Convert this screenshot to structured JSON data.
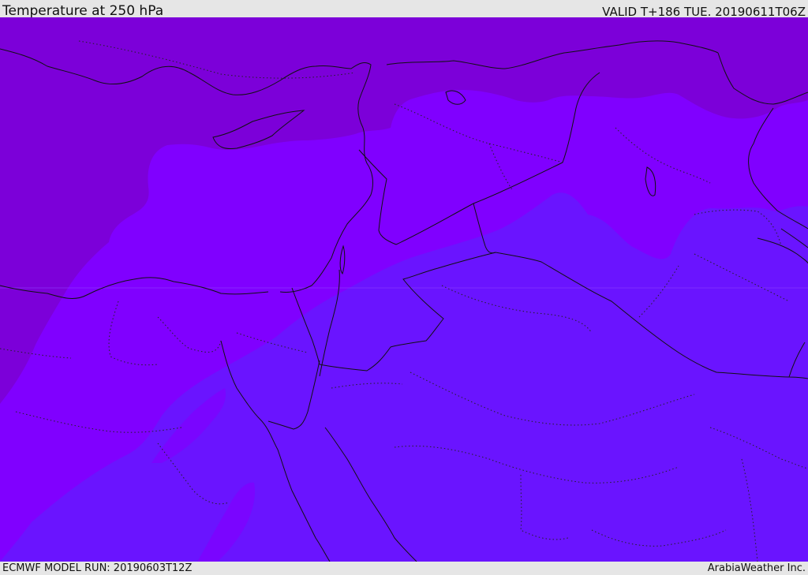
{
  "header": {
    "title": "Temperature at 250 hPa",
    "valid": "VALID T+186 TUE. 20190611T06Z"
  },
  "footer": {
    "model_run": "ECMWF MODEL RUN: 20190603T12Z",
    "credit": "ArabiaWeather Inc."
  },
  "map": {
    "colors": {
      "coldest": "#7c00d9",
      "cold": "#8000ff",
      "warm": "#6a14ff",
      "coast": "#111111",
      "border": "#111111"
    }
  }
}
